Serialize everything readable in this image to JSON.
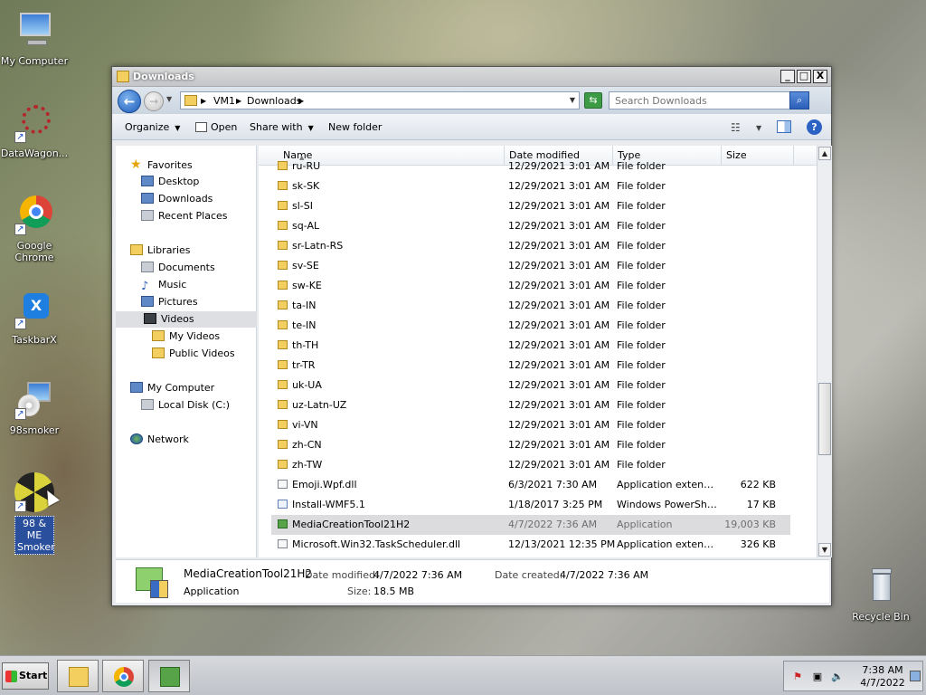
{
  "desktop": {
    "icons": [
      {
        "label": "My Computer"
      },
      {
        "label": "DataWagon..."
      },
      {
        "label": "Google Chrome"
      },
      {
        "label": "TaskbarX"
      },
      {
        "label": "98smoker"
      },
      {
        "label": "98 & ME Smoker"
      },
      {
        "label": "Recycle Bin"
      }
    ]
  },
  "window": {
    "title": "Downloads",
    "buttons": {
      "minimize": "_",
      "maximize": "□",
      "close": "X"
    },
    "address": {
      "crumbs": [
        "VM1",
        "Downloads"
      ]
    },
    "search": {
      "placeholder": "Search Downloads"
    },
    "toolbar": {
      "organize": "Organize",
      "open": "Open",
      "share_with": "Share with",
      "new_folder": "New folder"
    },
    "nav": {
      "favorites": "Favorites",
      "desktop": "Desktop",
      "downloads": "Downloads",
      "recent_places": "Recent Places",
      "libraries": "Libraries",
      "documents": "Documents",
      "music": "Music",
      "pictures": "Pictures",
      "videos": "Videos",
      "my_videos": "My Videos",
      "public_videos": "Public Videos",
      "my_computer": "My Computer",
      "local_disk": "Local Disk (C:)",
      "network": "Network"
    },
    "columns": {
      "name": "Name",
      "date": "Date modified",
      "type": "Type",
      "size": "Size"
    },
    "files": [
      {
        "name": "ru-RU",
        "date": "12/29/2021 3:01 AM",
        "type": "File folder",
        "size": "",
        "icon": "folder"
      },
      {
        "name": "sk-SK",
        "date": "12/29/2021 3:01 AM",
        "type": "File folder",
        "size": "",
        "icon": "folder"
      },
      {
        "name": "sl-SI",
        "date": "12/29/2021 3:01 AM",
        "type": "File folder",
        "size": "",
        "icon": "folder"
      },
      {
        "name": "sq-AL",
        "date": "12/29/2021 3:01 AM",
        "type": "File folder",
        "size": "",
        "icon": "folder"
      },
      {
        "name": "sr-Latn-RS",
        "date": "12/29/2021 3:01 AM",
        "type": "File folder",
        "size": "",
        "icon": "folder"
      },
      {
        "name": "sv-SE",
        "date": "12/29/2021 3:01 AM",
        "type": "File folder",
        "size": "",
        "icon": "folder"
      },
      {
        "name": "sw-KE",
        "date": "12/29/2021 3:01 AM",
        "type": "File folder",
        "size": "",
        "icon": "folder"
      },
      {
        "name": "ta-IN",
        "date": "12/29/2021 3:01 AM",
        "type": "File folder",
        "size": "",
        "icon": "folder"
      },
      {
        "name": "te-IN",
        "date": "12/29/2021 3:01 AM",
        "type": "File folder",
        "size": "",
        "icon": "folder"
      },
      {
        "name": "th-TH",
        "date": "12/29/2021 3:01 AM",
        "type": "File folder",
        "size": "",
        "icon": "folder"
      },
      {
        "name": "tr-TR",
        "date": "12/29/2021 3:01 AM",
        "type": "File folder",
        "size": "",
        "icon": "folder"
      },
      {
        "name": "uk-UA",
        "date": "12/29/2021 3:01 AM",
        "type": "File folder",
        "size": "",
        "icon": "folder"
      },
      {
        "name": "uz-Latn-UZ",
        "date": "12/29/2021 3:01 AM",
        "type": "File folder",
        "size": "",
        "icon": "folder"
      },
      {
        "name": "vi-VN",
        "date": "12/29/2021 3:01 AM",
        "type": "File folder",
        "size": "",
        "icon": "folder"
      },
      {
        "name": "zh-CN",
        "date": "12/29/2021 3:01 AM",
        "type": "File folder",
        "size": "",
        "icon": "folder"
      },
      {
        "name": "zh-TW",
        "date": "12/29/2021 3:01 AM",
        "type": "File folder",
        "size": "",
        "icon": "folder"
      },
      {
        "name": "Emoji.Wpf.dll",
        "date": "6/3/2021 7:30 AM",
        "type": "Application extension",
        "size": "622 KB",
        "icon": "dll"
      },
      {
        "name": "Install-WMF5.1",
        "date": "1/18/2017 3:25 PM",
        "type": "Windows PowerShel...",
        "size": "17 KB",
        "icon": "ps"
      },
      {
        "name": "MediaCreationTool21H2",
        "date": "4/7/2022 7:36 AM",
        "type": "Application",
        "size": "19,003 KB",
        "icon": "app",
        "selected": true
      },
      {
        "name": "Microsoft.Win32.TaskScheduler.dll",
        "date": "12/13/2021 12:35 PM",
        "type": "Application extension",
        "size": "326 KB",
        "icon": "dll"
      }
    ],
    "details": {
      "name": "MediaCreationTool21H2",
      "kind": "Application",
      "modified_label": "Date modified:",
      "modified": "4/7/2022 7:36 AM",
      "created_label": "Date created:",
      "created": "4/7/2022 7:36 AM",
      "size_label": "Size:",
      "size": "18.5 MB"
    }
  },
  "taskbar": {
    "start": "Start",
    "clock_time": "7:38 AM",
    "clock_date": "4/7/2022"
  }
}
